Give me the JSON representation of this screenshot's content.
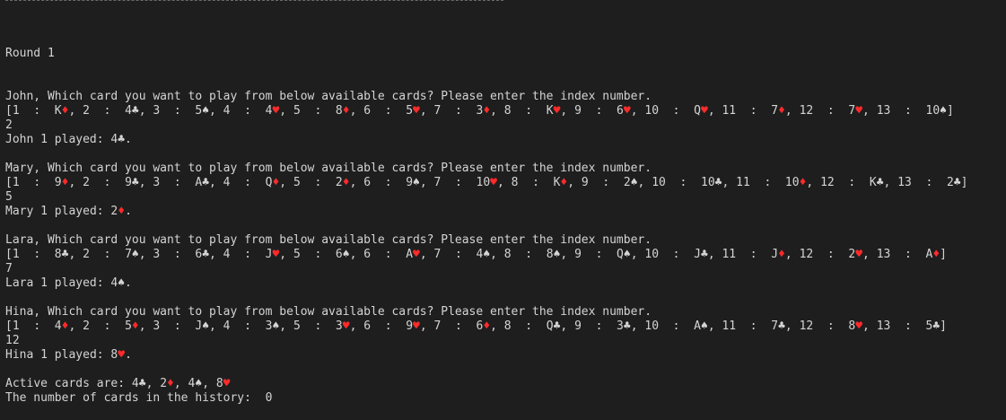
{
  "colors": {
    "background": "#1e1e1e",
    "text": "#d4d4d4",
    "red_suit": "#ff2b2b"
  },
  "lines": [
    {
      "text": "Round 1",
      "type": "header"
    },
    {
      "text": "",
      "type": "blank"
    },
    {
      "text": "",
      "type": "blank"
    },
    {
      "text": "John, Which card you want to play from below available cards? Please enter the index number.",
      "type": "prompt"
    },
    {
      "text": "[1  :  K♦, 2  :  4♣, 3  :  5♠, 4  :  4♥, 5  :  8♦, 6  :  5♥, 7  :  3♦, 8  :  K♥, 9  :  6♥, 10  :  Q♥, 11  :  7♦, 12  :  7♥, 13  :  10♠]",
      "type": "hand"
    },
    {
      "text": "2",
      "type": "input"
    },
    {
      "text": "John 1 played: 4♣.",
      "type": "result"
    },
    {
      "text": "",
      "type": "blank"
    },
    {
      "text": "Mary, Which card you want to play from below available cards? Please enter the index number.",
      "type": "prompt"
    },
    {
      "text": "[1  :  9♦, 2  :  9♣, 3  :  A♣, 4  :  Q♦, 5  :  2♦, 6  :  9♠, 7  :  10♥, 8  :  K♦, 9  :  2♠, 10  :  10♣, 11  :  10♦, 12  :  K♣, 13  :  2♣]",
      "type": "hand"
    },
    {
      "text": "5",
      "type": "input"
    },
    {
      "text": "Mary 1 played: 2♦.",
      "type": "result"
    },
    {
      "text": "",
      "type": "blank"
    },
    {
      "text": "Lara, Which card you want to play from below available cards? Please enter the index number.",
      "type": "prompt"
    },
    {
      "text": "[1  :  8♣, 2  :  7♠, 3  :  6♣, 4  :  J♥, 5  :  6♠, 6  :  A♥, 7  :  4♠, 8  :  8♠, 9  :  Q♠, 10  :  J♣, 11  :  J♦, 12  :  2♥, 13  :  A♦]",
      "type": "hand"
    },
    {
      "text": "7",
      "type": "input"
    },
    {
      "text": "Lara 1 played: 4♠.",
      "type": "result"
    },
    {
      "text": "",
      "type": "blank"
    },
    {
      "text": "Hina, Which card you want to play from below available cards? Please enter the index number.",
      "type": "prompt"
    },
    {
      "text": "[1  :  4♦, 2  :  5♦, 3  :  J♠, 4  :  3♠, 5  :  3♥, 6  :  9♥, 7  :  6♦, 8  :  Q♣, 9  :  3♣, 10  :  A♠, 11  :  7♣, 12  :  8♥, 13  :  5♣]",
      "type": "hand"
    },
    {
      "text": "12",
      "type": "input"
    },
    {
      "text": "Hina 1 played: 8♥.",
      "type": "result"
    },
    {
      "text": "",
      "type": "blank"
    },
    {
      "text": "Active cards are: 4♣, 2♦, 4♠, 8♥",
      "type": "summary"
    },
    {
      "text": "The number of cards in the history:  0",
      "type": "summary"
    }
  ]
}
